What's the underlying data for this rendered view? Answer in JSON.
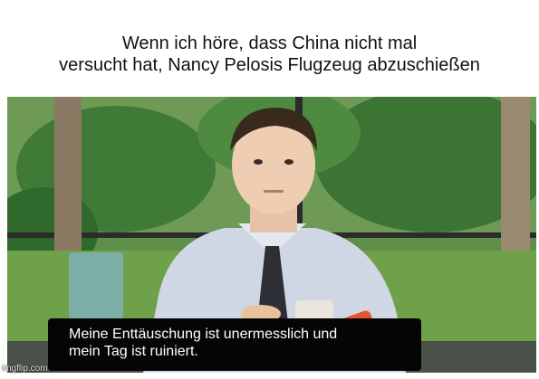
{
  "caption": {
    "line1": "Wenn ich höre, dass China nicht mal",
    "line2": "versucht hat, Nancy Pelosis Flugzeug abzuschießen"
  },
  "subtitle": {
    "line1": "Meine Enttäuschung ist unermesslich und",
    "line2": "mein Tag ist ruiniert."
  },
  "watermark": "imgflip.com",
  "colors": {
    "foliage": "#3f7a36",
    "shirt": "#cfd6e4",
    "subtitle_bg": "#050505"
  }
}
